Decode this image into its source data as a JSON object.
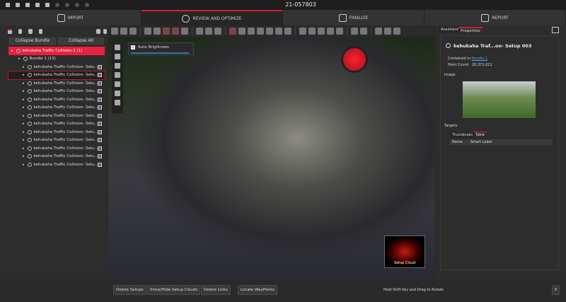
{
  "window": {
    "title": "21-057803"
  },
  "nav": {
    "tabs": [
      {
        "label": "IMPORT"
      },
      {
        "label": "REVIEW AND OPTIMIZE",
        "active": true
      },
      {
        "label": "FINALIZE"
      },
      {
        "label": "REPORT"
      }
    ]
  },
  "colors": {
    "accent": "#d0213a",
    "selected_row": "#e8213e"
  },
  "left": {
    "collapse_bundle": "Collapse Bundle",
    "collapse_all": "Collapse All",
    "tree": {
      "root": "kehukaha Traffic Collision-1 (1)",
      "bundle": "Bundle 1 (13)",
      "items": [
        "kehukaha Traffic Collision- Setu...",
        "kehukaha Traffic Collision- Setu...",
        "kehukaha Traffic Collision- Setu...",
        "kehukaha Traffic Collision- Setu...",
        "kehukaha Traffic Collision- Setu...",
        "kehukaha Traffic Collision- Setu...",
        "kehukaha Traffic Collision- Setu...",
        "kehukaha Traffic Collision- Setu...",
        "kehukaha Traffic Collision- Setu...",
        "kehukaha Traffic Collision- Setu...",
        "kehukaha Traffic Collision- Setu...",
        "kehukaha Traffic Collision- Setu...",
        "kehukaha Traffic Collision- Setu..."
      ]
    }
  },
  "viewport": {
    "auto_brightness": "Auto Brightness",
    "auto_brightness_checked": true,
    "setup_cloud": "Setup Cloud"
  },
  "right": {
    "tabs": [
      "Assistant",
      "Properties"
    ],
    "setup_title": "kehukaha Traf...on- Setup 003",
    "contained_in_label": "Contained in:",
    "contained_in_value": "Bundle 1",
    "point_count_label": "Point Count:",
    "point_count_value": "20,371,011",
    "image_label": "Image",
    "targets_label": "Targets",
    "target_tabs": [
      "Thumbnails",
      "Table"
    ],
    "columns": [
      "Name",
      "Smart Label"
    ]
  },
  "bottom": {
    "buttons": [
      "Delete Setups",
      "Show/Hide Setup Clouds",
      "Delete Links",
      "Locate WayPoints"
    ],
    "hint": "Hold Shift Key and Drag to Rotate",
    "close": "X"
  }
}
